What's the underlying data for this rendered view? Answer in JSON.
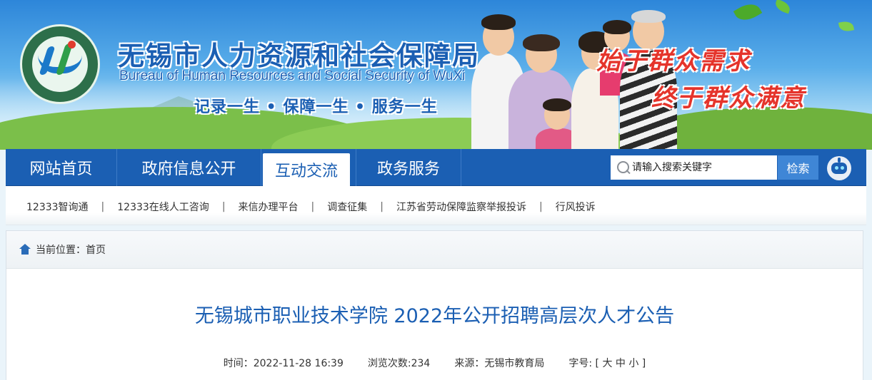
{
  "header": {
    "title": "无锡市人力资源和社会保障局",
    "subtitle": "Bureau of Human Resources and Social Security of WuXi",
    "motto": "记录一生 • 保障一生 • 服务一生",
    "slogan_line1": "始于群众需求",
    "slogan_line2": "终于群众满意"
  },
  "nav": {
    "tabs": [
      {
        "label": "网站首页"
      },
      {
        "label": "政府信息公开"
      },
      {
        "label": "互动交流"
      },
      {
        "label": "政务服务"
      }
    ],
    "active_tab": "互动交流",
    "search_placeholder": "请输入搜索关键字",
    "search_button": "检索"
  },
  "sublinks": [
    {
      "label": "12333智询通"
    },
    {
      "label": "12333在线人工咨询"
    },
    {
      "label": "来信办理平台"
    },
    {
      "label": "调查征集"
    },
    {
      "label": "江苏省劳动保障监察举报投诉"
    },
    {
      "label": "行风投诉"
    }
  ],
  "breadcrumb": {
    "prefix": "当前位置：",
    "home": "首页"
  },
  "article": {
    "title": "无锡城市职业技术学院 2022年公开招聘高层次人才公告",
    "time_label": "时间：",
    "time": "2022-11-28 16:39",
    "views_label": "浏览次数:",
    "views": "234",
    "source_label": "来源：",
    "source": "无锡市教育局",
    "font_label": "字号:",
    "font_open": "[",
    "font_large": "大",
    "font_medium": "中",
    "font_small": "小",
    "font_close": "]"
  },
  "colors": {
    "brand_blue": "#1b5fb3",
    "slogan_red": "#e5342b"
  }
}
